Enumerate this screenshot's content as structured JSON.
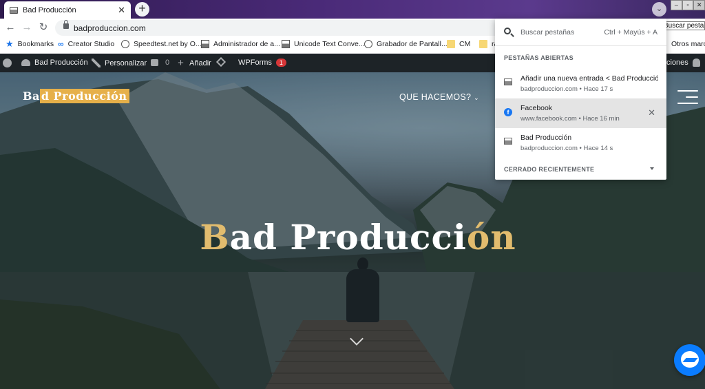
{
  "browser": {
    "tab_title": "Bad Producción",
    "url": "badproduccion.com",
    "tooltip": "Buscar pestañas"
  },
  "bookmarks": [
    {
      "label": "Bookmarks",
      "icon": "star-icon"
    },
    {
      "label": "Creator Studio",
      "icon": "meta-icon"
    },
    {
      "label": "Speedtest.net by O...",
      "icon": "globe-icon"
    },
    {
      "label": "Administrador de a...",
      "icon": "image-icon"
    },
    {
      "label": "Unicode Text Conve...",
      "icon": "image-icon"
    },
    {
      "label": "Grabador de Pantall...",
      "icon": "globe-icon"
    },
    {
      "label": "CM",
      "icon": "folder-icon"
    },
    {
      "label": "ra",
      "icon": "folder-icon"
    },
    {
      "label": "Otros marca",
      "icon": "folder-icon"
    }
  ],
  "adminbar": {
    "site": "Bad Producción",
    "customize": "Personalizar",
    "comments": "0",
    "add": "Añadir",
    "wpforms": "WPForms",
    "wpforms_badge": "1",
    "right_text": "ciones"
  },
  "site": {
    "logo_part1": "Ba",
    "logo_part2": "d Producción",
    "nav_item": "QUE HACEMOS?",
    "hero_title_a": "B",
    "hero_title_b": "ad Producci",
    "hero_title_c": "ón"
  },
  "tab_search": {
    "placeholder": "Buscar pestañas",
    "shortcut": "Ctrl + Mayús + A",
    "open_heading": "PESTAÑAS ABIERTAS",
    "recent_heading": "CERRADO RECIENTEMENTE",
    "tabs": [
      {
        "title": "Añadir una nueva entrada < Bad Producción",
        "subtitle": "badproduccion.com • Hace 17 s"
      },
      {
        "title": "Facebook",
        "subtitle": "www.facebook.com • Hace 16 min"
      },
      {
        "title": "Bad Producción",
        "subtitle": "badproduccion.com • Hace 14 s"
      }
    ]
  },
  "colors": {
    "accent_gold": "#e6b04a",
    "admin_bar": "#1d2327",
    "wp_badge": "#d63638",
    "messenger": "#0a7cff"
  }
}
